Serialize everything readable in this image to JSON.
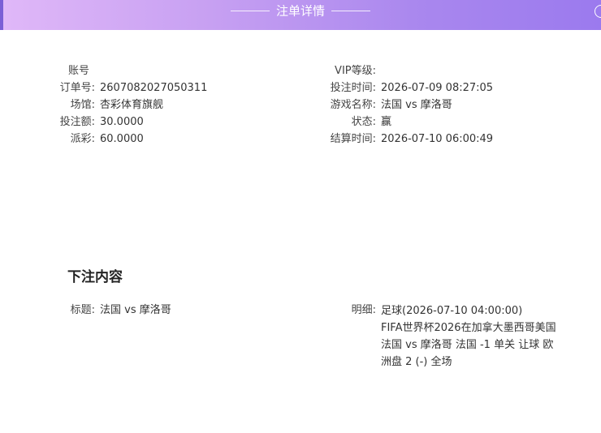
{
  "header": {
    "title": "注单详情"
  },
  "left_info": [
    {
      "label": "账号",
      "value": ""
    },
    {
      "label": "订单号:",
      "value": "2607082027050311"
    },
    {
      "label": "场馆:",
      "value": "杏彩体育旗舰"
    },
    {
      "label": "投注额:",
      "value": "30.0000"
    },
    {
      "label": "派彩:",
      "value": "60.0000"
    }
  ],
  "right_info": [
    {
      "label": "VIP等级:",
      "value": ""
    },
    {
      "label": "投注时间:",
      "value": "2026-07-09 08:27:05"
    },
    {
      "label": "游戏名称:",
      "value": "法国 vs 摩洛哥"
    },
    {
      "label": "状态:",
      "value": "赢"
    },
    {
      "label": "结算时间:",
      "value": "2026-07-10 06:00:49"
    }
  ],
  "bet_content": {
    "section_title": "下注内容",
    "title_label": "标题:",
    "title_value": "法国 vs 摩洛哥",
    "detail_label": "明细:",
    "detail_lines": [
      "足球(2026-07-10 04:00:00)",
      "FIFA世界杯2026在加拿大墨西哥美国",
      "法国 vs 摩洛哥 法国 -1 单关 让球 欧",
      "洲盘 2 (-) 全场"
    ]
  }
}
